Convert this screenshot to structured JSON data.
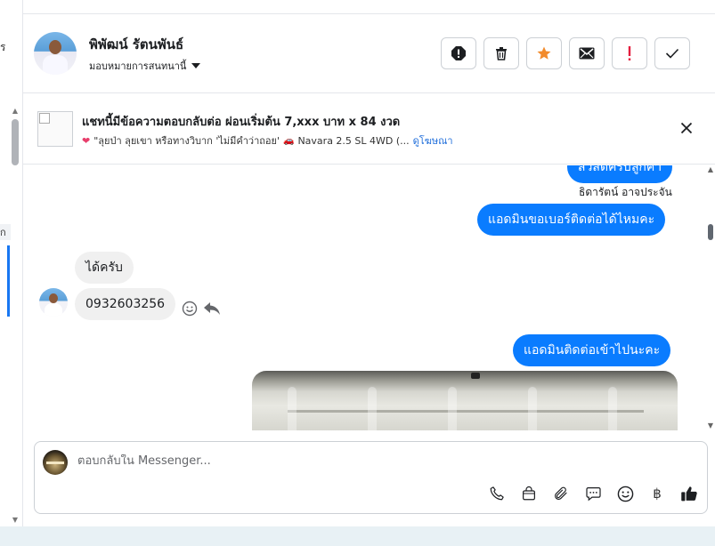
{
  "left_panel": {
    "fragment_top": "ร",
    "fragment_mid": "ก"
  },
  "header": {
    "contact_name": "พิพัฒน์ รัตนพันธ์",
    "assign_label": "มอบหมายการสนทนานี้"
  },
  "ad_context": {
    "title": "แชทนี้มีข้อความตอบกลับต่อ ผ่อนเริ่มต้น 7,xxx บาท x 84 งวด",
    "subtitle": "\"ลุยป่า ลุยเขา หรือทางวิบาก 'ไม่มีคำว่าถอย'",
    "car_model": "Navara 2.5 SL 4WD (...",
    "view_ad_link": "ดูโฆษณา"
  },
  "messages": {
    "out_partial": "สวัสดีครับลูกค้า",
    "sender_name": "ธิดารัตน์ อาจประจัน",
    "out_ask_phone": "แอดมินขอเบอร์ติดต่อได้ไหมคะ",
    "in_ok": "ได้ครับ",
    "in_phone": "0932603256",
    "out_will_contact": "แอดมินติดต่อเข้าไปนะคะ"
  },
  "composer": {
    "placeholder": "ตอบกลับใน Messenger..."
  },
  "colors": {
    "messenger_blue": "#0a7cff",
    "star_orange": "#f28b2c",
    "alert_red": "#e41e3f",
    "link_blue": "#216fdb"
  },
  "icons": {
    "header_actions": [
      "spam-icon",
      "trash-icon",
      "star-icon",
      "envelope-icon",
      "exclamation-icon",
      "check-icon"
    ],
    "composer_tools": [
      "phone-icon",
      "shopping-bag-icon",
      "paperclip-icon",
      "saved-replies-icon",
      "emoji-icon",
      "baht-icon",
      "thumbs-up-icon"
    ]
  }
}
